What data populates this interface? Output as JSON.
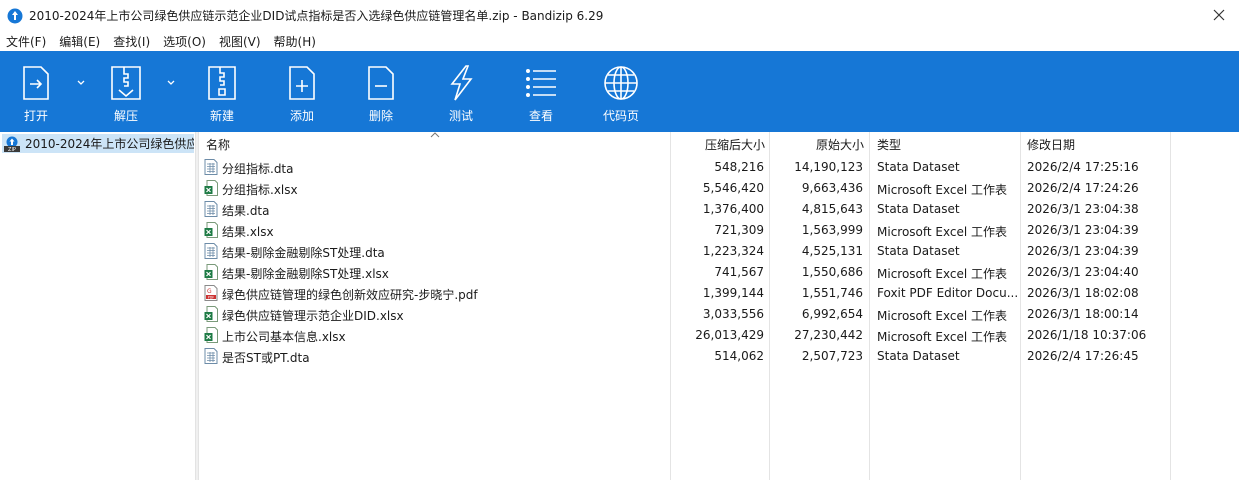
{
  "window": {
    "title": "2010-2024年上市公司绿色供应链示范企业DID试点指标是否入选绿色供应链管理名单.zip - Bandizip 6.29"
  },
  "menu": [
    "文件(F)",
    "编辑(E)",
    "查找(I)",
    "选项(O)",
    "视图(V)",
    "帮助(H)"
  ],
  "toolbar": {
    "open": "打开",
    "extract": "解压",
    "new": "新建",
    "add": "添加",
    "delete": "删除",
    "test": "测试",
    "view": "查看",
    "codepage": "代码页"
  },
  "tree": {
    "root_label": "2010-2024年上市公司绿色供应"
  },
  "columns": {
    "name": "名称",
    "packed": "压缩后大小",
    "size": "原始大小",
    "type": "类型",
    "modified": "修改日期"
  },
  "files": [
    {
      "name": "分组指标.dta",
      "packed": "548,216",
      "size": "14,190,123",
      "type": "Stata Dataset",
      "modified": "2026/2/4 17:25:16",
      "icon": "stata-file-icon"
    },
    {
      "name": "分组指标.xlsx",
      "packed": "5,546,420",
      "size": "9,663,436",
      "type": "Microsoft Excel 工作表",
      "modified": "2026/2/4 17:24:26",
      "icon": "excel-file-icon"
    },
    {
      "name": "结果.dta",
      "packed": "1,376,400",
      "size": "4,815,643",
      "type": "Stata Dataset",
      "modified": "2026/3/1 23:04:38",
      "icon": "stata-file-icon"
    },
    {
      "name": "结果.xlsx",
      "packed": "721,309",
      "size": "1,563,999",
      "type": "Microsoft Excel 工作表",
      "modified": "2026/3/1 23:04:39",
      "icon": "excel-file-icon"
    },
    {
      "name": "结果-剔除金融剔除ST处理.dta",
      "packed": "1,223,324",
      "size": "4,525,131",
      "type": "Stata Dataset",
      "modified": "2026/3/1 23:04:39",
      "icon": "stata-file-icon"
    },
    {
      "name": "结果-剔除金融剔除ST处理.xlsx",
      "packed": "741,567",
      "size": "1,550,686",
      "type": "Microsoft Excel 工作表",
      "modified": "2026/3/1 23:04:40",
      "icon": "excel-file-icon"
    },
    {
      "name": "绿色供应链管理的绿色创新效应研究-步晓宁.pdf",
      "packed": "1,399,144",
      "size": "1,551,746",
      "type": "Foxit PDF Editor Docu...",
      "modified": "2026/3/1 18:02:08",
      "icon": "pdf-file-icon"
    },
    {
      "name": "绿色供应链管理示范企业DID.xlsx",
      "packed": "3,033,556",
      "size": "6,992,654",
      "type": "Microsoft Excel 工作表",
      "modified": "2026/3/1 18:00:14",
      "icon": "excel-file-icon"
    },
    {
      "name": "上市公司基本信息.xlsx",
      "packed": "26,013,429",
      "size": "27,230,442",
      "type": "Microsoft Excel 工作表",
      "modified": "2026/1/18 10:37:06",
      "icon": "excel-file-icon"
    },
    {
      "name": "是否ST或PT.dta",
      "packed": "514,062",
      "size": "2,507,723",
      "type": "Stata Dataset",
      "modified": "2026/2/4 17:26:45",
      "icon": "stata-file-icon"
    }
  ],
  "colors": {
    "toolbar_bg": "#1677d6",
    "selection_bg": "#cce4f7"
  }
}
